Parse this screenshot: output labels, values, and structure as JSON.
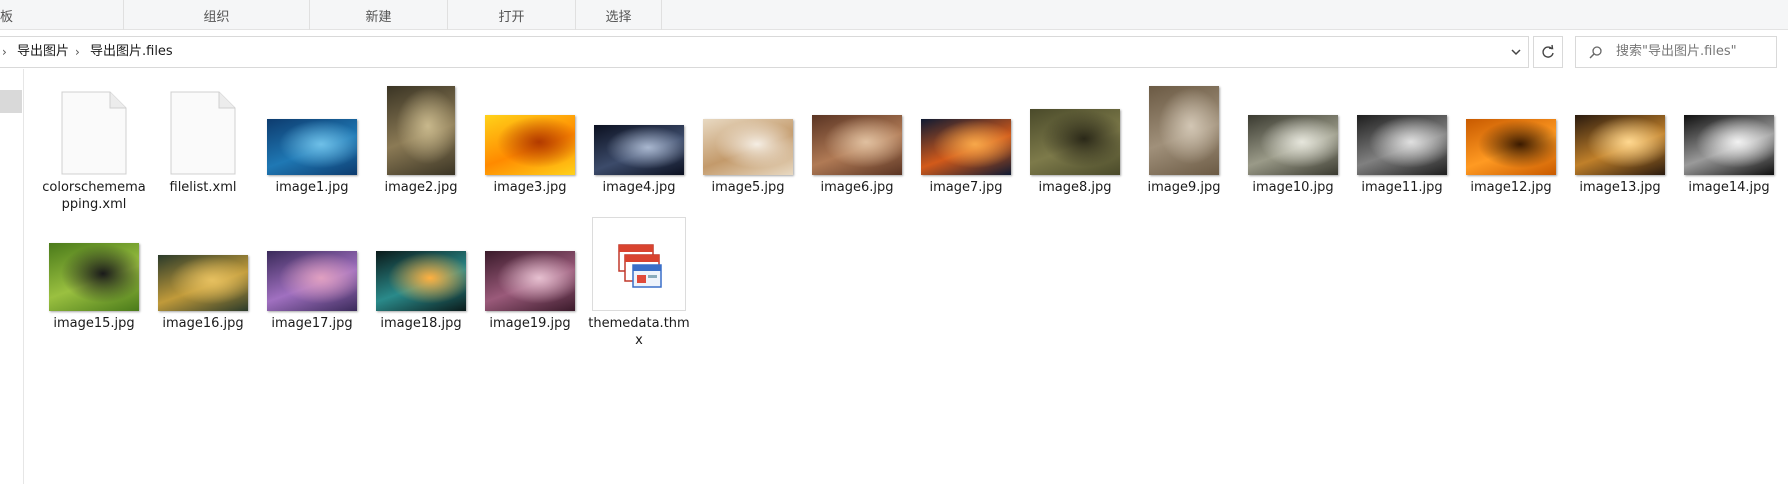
{
  "ribbon": {
    "groups": [
      "板",
      "组织",
      "新建",
      "打开",
      "选择"
    ]
  },
  "address": {
    "crumbs": [
      "导出图片",
      "导出图片.files"
    ]
  },
  "search": {
    "placeholder": "搜索\"导出图片.files\""
  },
  "files": [
    {
      "name": "colorschememapping.xml",
      "kind": "doc"
    },
    {
      "name": "filelist.xml",
      "kind": "doc"
    },
    {
      "name": "image1.jpg",
      "kind": "img",
      "colors": [
        "#0d3b6e",
        "#1f78b4",
        "#6fc0e8"
      ]
    },
    {
      "name": "image2.jpg",
      "kind": "img",
      "colors": [
        "#3a3424",
        "#8b7a55",
        "#c8b88c"
      ]
    },
    {
      "name": "image3.jpg",
      "kind": "img",
      "colors": [
        "#ffd21a",
        "#ff8a00",
        "#b23a00"
      ]
    },
    {
      "name": "image4.jpg",
      "kind": "img",
      "colors": [
        "#0b1020",
        "#3c4b6a",
        "#a9b7cf"
      ]
    },
    {
      "name": "image5.jpg",
      "kind": "img",
      "colors": [
        "#e8d9c2",
        "#c39a6b",
        "#f5eee4"
      ]
    },
    {
      "name": "image6.jpg",
      "kind": "img",
      "colors": [
        "#5a3423",
        "#b07a55",
        "#e0c0a0"
      ]
    },
    {
      "name": "image7.jpg",
      "kind": "img",
      "colors": [
        "#0f1a33",
        "#d25a1a",
        "#f7a84a"
      ]
    },
    {
      "name": "image8.jpg",
      "kind": "img",
      "colors": [
        "#4a4a2a",
        "#7d7a4a",
        "#2a2818"
      ]
    },
    {
      "name": "image9.jpg",
      "kind": "img",
      "colors": [
        "#6b5a44",
        "#a0907a",
        "#d2c6b4"
      ]
    },
    {
      "name": "image10.jpg",
      "kind": "img",
      "colors": [
        "#3a3a30",
        "#9a9a88",
        "#e6e6dc"
      ]
    },
    {
      "name": "image11.jpg",
      "kind": "img",
      "colors": [
        "#1e1e1e",
        "#808080",
        "#e0e0e0"
      ]
    },
    {
      "name": "image12.jpg",
      "kind": "img",
      "colors": [
        "#c85a00",
        "#ff9a22",
        "#3a1a00"
      ]
    },
    {
      "name": "image13.jpg",
      "kind": "img",
      "colors": [
        "#2a1a0e",
        "#c0802a",
        "#ffd890"
      ]
    },
    {
      "name": "image14.jpg",
      "kind": "img",
      "colors": [
        "#101010",
        "#9a9a9a",
        "#f2f2f2"
      ]
    },
    {
      "name": "image15.jpg",
      "kind": "img",
      "colors": [
        "#4a7a1a",
        "#9ac040",
        "#1a1a1a"
      ]
    },
    {
      "name": "image16.jpg",
      "kind": "img",
      "colors": [
        "#2a3a2a",
        "#c09a3a",
        "#e6c060"
      ]
    },
    {
      "name": "image17.jpg",
      "kind": "img",
      "colors": [
        "#3a2a5a",
        "#a070c0",
        "#e0a0c0"
      ]
    },
    {
      "name": "image18.jpg",
      "kind": "img",
      "colors": [
        "#0a1a1a",
        "#2a8a8a",
        "#ffb040"
      ]
    },
    {
      "name": "image19.jpg",
      "kind": "img",
      "colors": [
        "#3a1a2a",
        "#9a5a7a",
        "#e6c0d0"
      ]
    },
    {
      "name": "themedata.thmx",
      "kind": "theme"
    }
  ]
}
